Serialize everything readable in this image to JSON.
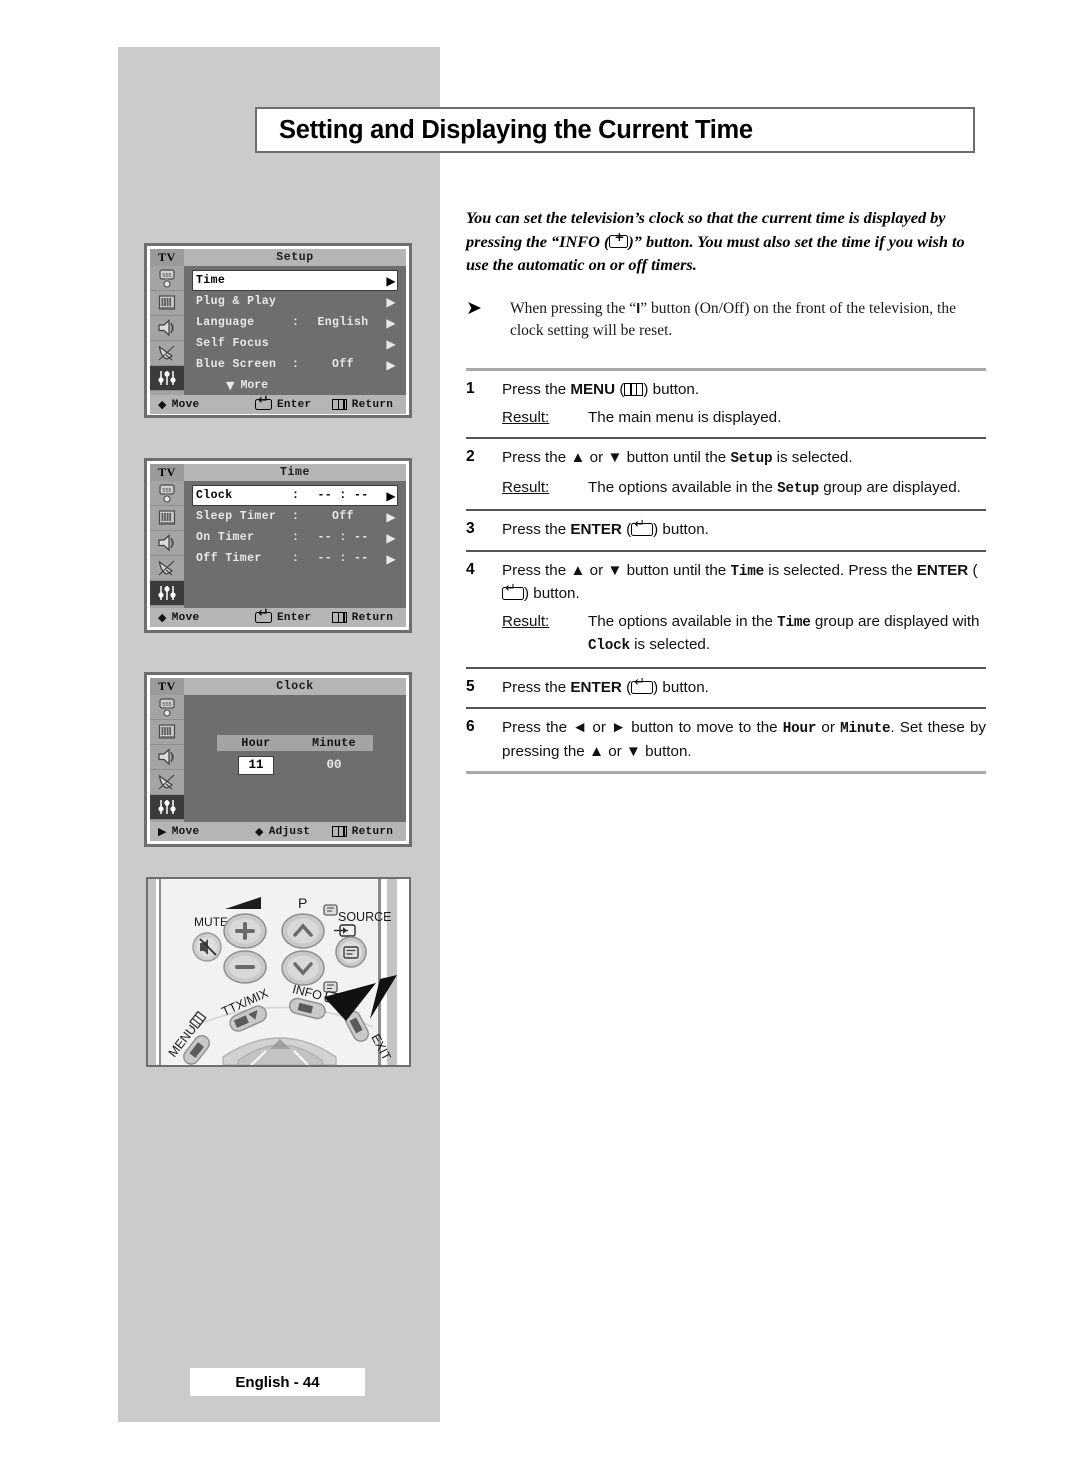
{
  "page": {
    "title": "Setting and Displaying the Current Time",
    "footer": "English - 44"
  },
  "intro": {
    "part1": "You can set the television’s clock so that the current time is displayed by pressing the “INFO (",
    "part2": ")” button. You must also set the time if you wish to use the automatic on or off timers."
  },
  "note": {
    "arrow": "➤",
    "part1": "When pressing the “",
    "power_symbol": "I",
    "part2": "” button (On/Off) on the front of the television, the clock setting will be reset."
  },
  "steps": [
    {
      "num": "1",
      "text_before": "Press the ",
      "bold": "MENU",
      "icon": "menu-icon",
      "text_after": " button.",
      "result_label": "Result:",
      "result_text": "The main menu is displayed."
    },
    {
      "num": "2",
      "text_before": "Press the ▲ or ▼ button until the ",
      "mono": "Setup",
      "text_after": " is selected.",
      "result_label": "Result:",
      "result_before": "The options available in the ",
      "result_mono": "Setup",
      "result_after": " group are displayed."
    },
    {
      "num": "3",
      "text_before": "Press the ",
      "bold": "ENTER",
      "icon": "enter-icon",
      "text_after": " button."
    },
    {
      "num": "4",
      "text_before": "Press the ▲ or ▼ button until the ",
      "mono": "Time",
      "text_mid": " is selected. Press the ",
      "bold": "ENTER",
      "icon": "enter-icon",
      "text_after": " button.",
      "result_label": "Result:",
      "result_before": "The options available in the ",
      "result_mono": "Time",
      "result_mid": " group are displayed with ",
      "result_mono2": "Clock",
      "result_after": " is selected."
    },
    {
      "num": "5",
      "text_before": "Press the ",
      "bold": "ENTER",
      "icon": "enter-icon",
      "text_after": " button."
    },
    {
      "num": "6",
      "text_before": "Press the ◄ or ► button to move to the ",
      "mono": "Hour",
      "text_mid": " or ",
      "mono2": "Minute",
      "text_after": ". Set these by pressing the ▲ or ▼ button."
    }
  ],
  "osd_setup": {
    "tv_label": "TV",
    "title": "Setup",
    "rows": [
      {
        "label": "Time",
        "colon": "",
        "value": "",
        "arrow": "▶",
        "selected": true
      },
      {
        "label": "Plug & Play",
        "colon": "",
        "value": "",
        "arrow": "▶",
        "selected": false
      },
      {
        "label": "Language",
        "colon": ":",
        "value": "English",
        "arrow": "▶",
        "selected": false
      },
      {
        "label": "Self Focus",
        "colon": "",
        "value": "",
        "arrow": "▶",
        "selected": false
      },
      {
        "label": "Blue Screen",
        "colon": ":",
        "value": "Off",
        "arrow": "▶",
        "selected": false
      }
    ],
    "more": "More",
    "more_arrow": "▼",
    "bottom": {
      "move": "Move",
      "enter": "Enter",
      "return": "Return"
    }
  },
  "osd_time": {
    "tv_label": "TV",
    "title": "Time",
    "rows": [
      {
        "label": "Clock",
        "colon": ":",
        "value": "-- : --",
        "arrow": "▶",
        "selected": true
      },
      {
        "label": "Sleep Timer",
        "colon": ":",
        "value": "Off",
        "arrow": "▶",
        "selected": false
      },
      {
        "label": "On Timer",
        "colon": ":",
        "value": "-- : --",
        "arrow": "▶",
        "selected": false
      },
      {
        "label": "Off Timer",
        "colon": ":",
        "value": "-- : --",
        "arrow": "▶",
        "selected": false
      }
    ],
    "bottom": {
      "move": "Move",
      "enter": "Enter",
      "return": "Return"
    }
  },
  "osd_clock": {
    "tv_label": "TV",
    "title": "Clock",
    "hour_header": "Hour",
    "minute_header": "Minute",
    "hour_value": "11",
    "minute_value": "00",
    "bottom": {
      "move": "Move",
      "adjust": "Adjust",
      "return": "Return"
    }
  },
  "remote": {
    "mute": "MUTE",
    "volume_plus": "+",
    "volume_minus": "−",
    "program": "P",
    "source": "SOURCE",
    "ttx_mix": "TTX/MIX",
    "info": "INFO",
    "menu": "MENU",
    "exit": "EXIT"
  },
  "colors": {
    "band": "#cbcbcb",
    "osd_bg": "#6e6e6e",
    "osd_bar": "#b5b5b5",
    "osd_sidebar": "#a4a4a4",
    "rule": "#a9a9a9"
  }
}
